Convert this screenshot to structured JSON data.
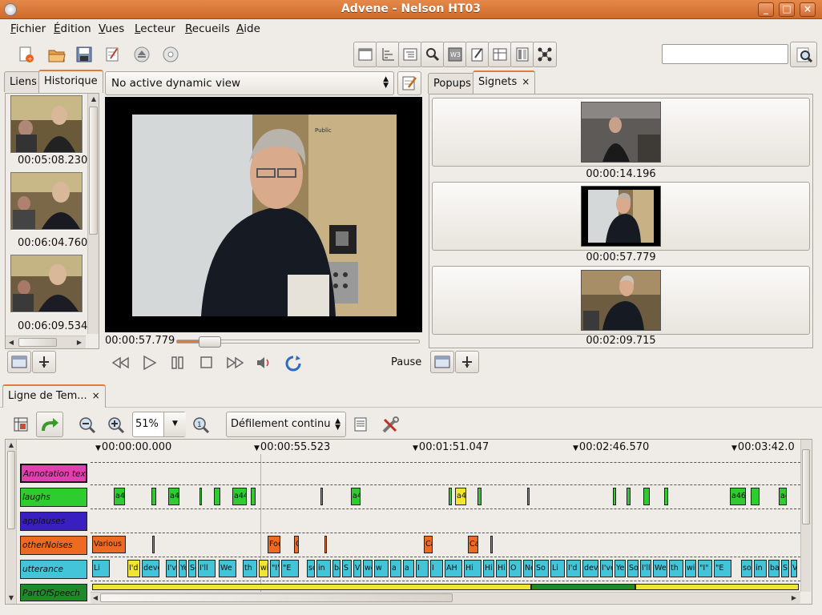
{
  "window": {
    "title": "Advene - Nelson HT03",
    "controls": [
      "_",
      "□",
      "×"
    ]
  },
  "menu": [
    {
      "label": "Fichier",
      "accel": "F"
    },
    {
      "label": "Édition",
      "accel": "É"
    },
    {
      "label": "Vues",
      "accel": "V"
    },
    {
      "label": "Lecteur",
      "accel": "L"
    },
    {
      "label": "Recueils",
      "accel": "R"
    },
    {
      "label": "Aide",
      "accel": "A"
    }
  ],
  "search": {
    "placeholder": ""
  },
  "left_panel": {
    "tabs": [
      {
        "label": "Liens",
        "active": false
      },
      {
        "label": "Historique",
        "active": true
      }
    ],
    "history": [
      "00:05:08.230",
      "00:06:04.760",
      "00:06:09.534"
    ]
  },
  "player": {
    "dynamic_view": "No active dynamic view",
    "current_time": "00:00:57.779",
    "position_fraction": 0.13,
    "status": "Pause"
  },
  "right_panel": {
    "tabs": [
      {
        "label": "Popups",
        "active": false
      },
      {
        "label": "Signets",
        "active": true,
        "closable": "×"
      }
    ],
    "bookmarks": [
      "00:00:14.196",
      "00:00:57.779",
      "00:02:09.715"
    ]
  },
  "timeline": {
    "tab_label": "Ligne de Tem...",
    "tab_close": "×",
    "zoom": "51%",
    "scroll_mode": "Défilement continu",
    "ticks": [
      "00:00:00.000",
      "00:00:55.523",
      "00:01:51.047",
      "00:02:46.570",
      "00:03:42.0"
    ],
    "rows": [
      {
        "label": "Annotation texte",
        "color": "#e040b0"
      },
      {
        "label": "laughs",
        "color": "#2ecc2e"
      },
      {
        "label": "applauses",
        "color": "#3a1fc0"
      },
      {
        "label": "otherNoises",
        "color": "#ee6a22"
      },
      {
        "label": "utterance",
        "color": "#44c4d8"
      },
      {
        "label": "PartOfSpeech",
        "color": "#1f8a2a"
      }
    ],
    "annotations": {
      "laughs": [
        "a4",
        "a4",
        "a44",
        "a4",
        "a4",
        "a46",
        "a4"
      ],
      "otherNoises": [
        "Various",
        "Foo",
        "C",
        "Ca",
        "Ca"
      ],
      "utterance": [
        "Li",
        "I'd",
        "deve",
        "I've",
        "Ye",
        "So",
        "I'll",
        "We",
        "th",
        "wi",
        "\"I\"",
        "\"E",
        "so",
        "in",
        "ba",
        "S",
        "V",
        "we",
        "w",
        "a",
        "a",
        "I",
        "I",
        "AH",
        "Hi",
        "Hi",
        "Hi",
        "O",
        "No",
        "So"
      ]
    }
  },
  "colors": {
    "accent": "#e07b3c",
    "highlight": "#f0e632"
  }
}
